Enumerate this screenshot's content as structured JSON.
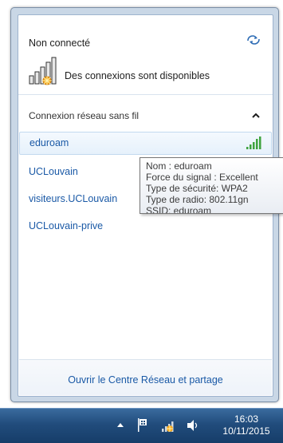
{
  "header": {
    "status_title": "Non connecté",
    "available_text": "Des connexions sont disponibles"
  },
  "section": {
    "title": "Connexion réseau sans fil"
  },
  "networks": [
    {
      "name": "eduroam",
      "selected": true
    },
    {
      "name": "UCLouvain",
      "selected": false
    },
    {
      "name": "visiteurs.UCLouvain",
      "selected": false
    },
    {
      "name": "UCLouvain-prive",
      "selected": false
    }
  ],
  "tooltip": {
    "line1": "Nom : eduroam",
    "line2": "Force du signal : Excellent",
    "line3": "Type de sécurité: WPA2",
    "line4": "Type de radio: 802.11gn",
    "line5": "SSID: eduroam"
  },
  "footer": {
    "link": "Ouvrir le Centre Réseau et partage"
  },
  "taskbar": {
    "time": "16:03",
    "date": "10/11/2015"
  },
  "icons": {
    "refresh": "refresh-icon",
    "signal": "signal-bars-icon",
    "collapse": "chevron-up-icon",
    "tray_up": "triangle-up-icon",
    "flag": "action-center-flag-icon",
    "network": "network-status-icon",
    "volume": "speaker-icon"
  },
  "colors": {
    "link": "#1a59a6",
    "signal_green": "#3ea33e",
    "taskbar": "#214c7c"
  }
}
